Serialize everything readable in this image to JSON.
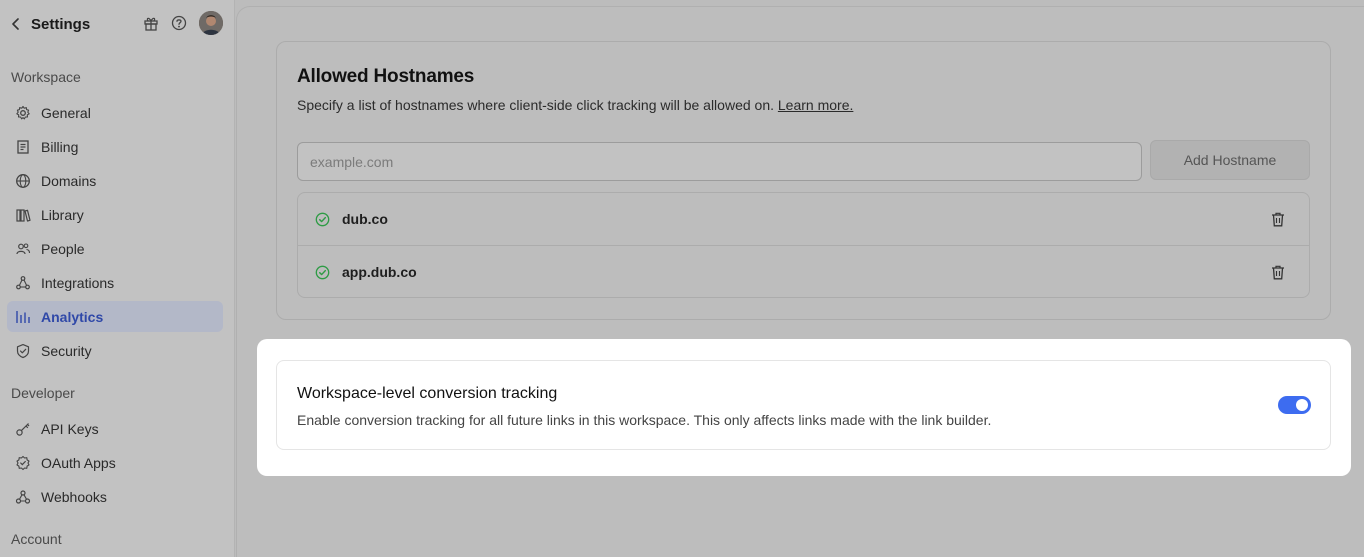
{
  "sidebar": {
    "title": "Settings",
    "header_icons": [
      "gift-icon",
      "help-circle-icon"
    ],
    "sections": [
      {
        "label": "Workspace"
      },
      {
        "label": "Developer"
      },
      {
        "label": "Account"
      }
    ],
    "items": [
      {
        "label": "General",
        "icon": "gear-icon"
      },
      {
        "label": "Billing",
        "icon": "receipt-icon"
      },
      {
        "label": "Domains",
        "icon": "globe-icon"
      },
      {
        "label": "Library",
        "icon": "library-icon"
      },
      {
        "label": "People",
        "icon": "users-icon"
      },
      {
        "label": "Integrations",
        "icon": "integrations-icon"
      },
      {
        "label": "Analytics",
        "icon": "bar-chart-icon",
        "active": true
      },
      {
        "label": "Security",
        "icon": "shield-check-icon"
      },
      {
        "label": "API Keys",
        "icon": "key-icon"
      },
      {
        "label": "OAuth Apps",
        "icon": "oauth-icon"
      },
      {
        "label": "Webhooks",
        "icon": "webhook-icon"
      }
    ]
  },
  "hostnames": {
    "title": "Allowed Hostnames",
    "description": "Specify a list of hostnames where client-side click tracking will be allowed on.",
    "learn_more": "Learn more.",
    "input_placeholder": "example.com",
    "add_button": "Add Hostname",
    "list": [
      {
        "name": "dub.co"
      },
      {
        "name": "app.dub.co"
      }
    ]
  },
  "conversion": {
    "title": "Workspace-level conversion tracking",
    "description": "Enable conversion tracking for all future links in this workspace. This only affects links made with the link builder.",
    "enabled": true
  },
  "colors": {
    "accent": "#3d6cf0",
    "active_nav_text": "#2f48a8",
    "success": "#2e9b45"
  }
}
